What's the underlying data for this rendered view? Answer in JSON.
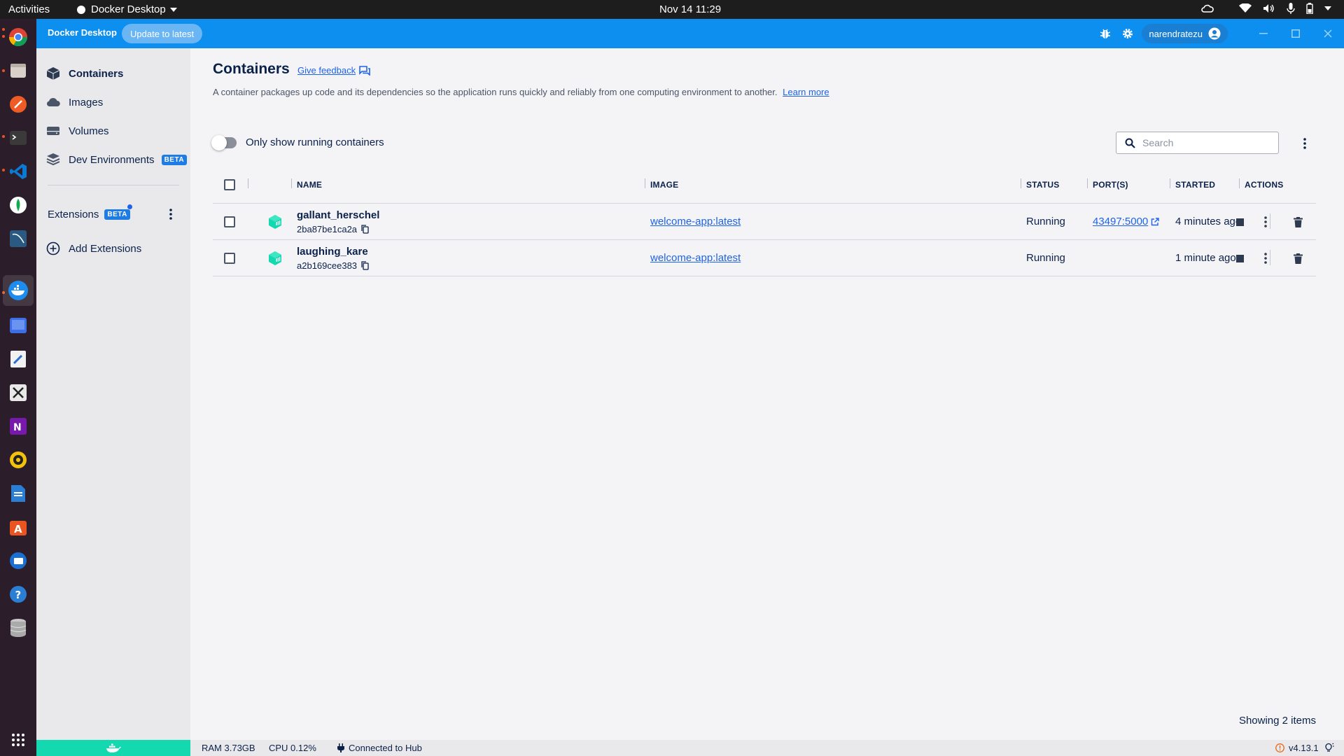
{
  "topbar": {
    "activities": "Activities",
    "app_name": "Docker Desktop",
    "clock": "Nov 14  11:29"
  },
  "header": {
    "brand": "Docker Desktop",
    "update_label": "Update to latest",
    "username": "narendratezu"
  },
  "sidebar": {
    "items": [
      {
        "label": "Containers",
        "icon": "containers-icon"
      },
      {
        "label": "Images",
        "icon": "cloud-icon"
      },
      {
        "label": "Volumes",
        "icon": "volume-icon"
      },
      {
        "label": "Dev Environments",
        "icon": "dev-env-icon",
        "badge": "BETA"
      }
    ],
    "extensions_label": "Extensions",
    "extensions_badge": "BETA",
    "add_extensions_label": "Add Extensions"
  },
  "main": {
    "title": "Containers",
    "feedback_label": "Give feedback",
    "description": "A container packages up code and its dependencies so the application runs quickly and reliably from one computing environment to another.",
    "learn_more": "Learn more",
    "toggle_label": "Only show running containers",
    "toggle_on": false,
    "search_placeholder": "Search",
    "showing": "Showing 2 items"
  },
  "table": {
    "columns": {
      "name": "NAME",
      "image": "IMAGE",
      "status": "STATUS",
      "ports": "PORT(S)",
      "started": "STARTED",
      "actions": "ACTIONS"
    },
    "rows": [
      {
        "name": "gallant_herschel",
        "id": "2ba87be1ca2a",
        "image": "welcome-app:latest",
        "status": "Running",
        "port": "43497:5000",
        "started": "4 minutes ago"
      },
      {
        "name": "laughing_kare",
        "id": "a2b169cee383",
        "image": "welcome-app:latest",
        "status": "Running",
        "port": "",
        "started": "1 minute ago"
      }
    ]
  },
  "footer": {
    "ram": "RAM 3.73GB",
    "cpu": "CPU 0.12%",
    "hub": "Connected to Hub",
    "version": "v4.13.1"
  },
  "colors": {
    "header_blue": "#0c8fef",
    "accent": "#1d63ed",
    "running_green": "#13d8b0"
  }
}
